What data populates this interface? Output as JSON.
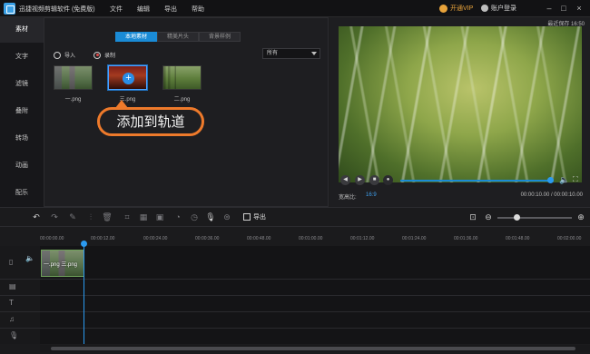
{
  "app": {
    "title": "迅捷视频剪辑软件 (免费版)",
    "menu": [
      "文件",
      "编辑",
      "导出",
      "帮助"
    ],
    "vip_label": "开通VIP",
    "login_label": "账户登录",
    "window_controls": [
      "minimize-icon",
      "maximize-icon",
      "close-icon"
    ]
  },
  "sidebar": {
    "items": [
      {
        "label": "素材",
        "active": true
      },
      {
        "label": "文字",
        "active": false
      },
      {
        "label": "滤镜",
        "active": false
      },
      {
        "label": "叠附",
        "active": false
      },
      {
        "label": "转场",
        "active": false
      },
      {
        "label": "动画",
        "active": false
      },
      {
        "label": "配乐",
        "active": false
      }
    ]
  },
  "media": {
    "tabs": [
      {
        "label": "本地素材",
        "active": true
      },
      {
        "label": "精美片头",
        "active": false
      },
      {
        "label": "背景样例",
        "active": false
      }
    ],
    "import_label": "导入",
    "record_label": "录制",
    "filter_value": "所有",
    "thumbnails": [
      {
        "label": "一.png",
        "selected": false
      },
      {
        "label": "三.png",
        "selected": true
      },
      {
        "label": "二.png",
        "selected": false
      }
    ],
    "callout": "添加到轨道"
  },
  "preview": {
    "saved_text": "最近保存 16:50",
    "aspect_label": "宽高比:",
    "aspect_value": "16:9",
    "timecode": "00:00:10.00 / 00:00:10.00",
    "progress": 1.0
  },
  "toolbar": {
    "export_label": "导出",
    "zoom_level": 0.25
  },
  "timeline": {
    "ticks": [
      "00:00:00.00",
      "00:00:12.00",
      "00:00:24.00",
      "00:00:36.00",
      "00:00:48.00",
      "00:01:00.00",
      "00:01:12.00",
      "00:01:24.00",
      "00:01:36.00",
      "00:01:48.00",
      "00:02:00.00"
    ],
    "clip_label": "一.png 三.png",
    "tracks": [
      "video-track-icon",
      "overlay-track-icon",
      "text-track-icon",
      "music-track-icon",
      "voice-track-icon"
    ]
  },
  "colors": {
    "accent": "#1a8bd6",
    "callout_border": "#ee7a2b",
    "vip": "#e8a33b"
  }
}
